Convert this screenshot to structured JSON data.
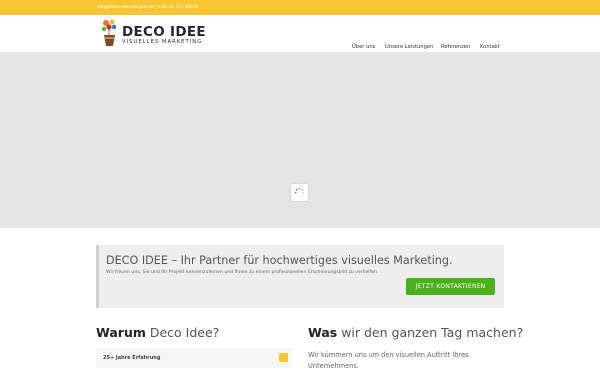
{
  "topbar": {
    "contact_text": "info@deco-idee-beispiel.de | +49 (0) 123 45678"
  },
  "header": {
    "logo_title": "DECO IDEE",
    "logo_subtitle": "VISUELLES MARKETING",
    "nav": [
      "Über uns",
      "Unsere Leistungen",
      "Referenzen",
      "Kontakt"
    ]
  },
  "cta": {
    "heading": "DECO IDEE – Ihr Partner für hochwertiges visuelles Marketing.",
    "text": "Wir freuen uns, Sie und Ihr Projekt kennenzulernen und Ihnen zu einem professionellen Erscheinungsbild zu verhelfen.",
    "button_label": "JETZT KONTAKTIEREN"
  },
  "left_column": {
    "heading_bold": "Warum",
    "heading_rest": " Deco Idee?",
    "accordion_item": "25+ Jahre Erfahrung"
  },
  "right_column": {
    "heading_bold": "Was",
    "heading_rest": " wir den ganzen Tag machen?",
    "text": "Wir kümmern uns um den visuellen Auftritt Ihres Unternehmens."
  },
  "colors": {
    "accent": "#f7c531",
    "button": "#4caf1c",
    "dark": "#1f2733"
  }
}
